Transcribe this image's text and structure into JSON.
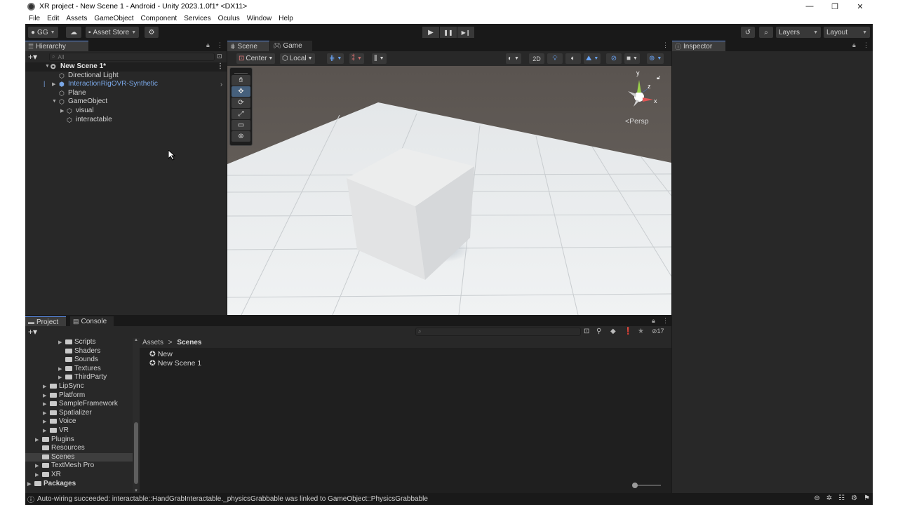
{
  "window": {
    "title": "XR project - New Scene 1 - Android - Unity 2023.1.0f1* <DX11>",
    "controls": [
      "—",
      "❐",
      "✕"
    ]
  },
  "menu": [
    "File",
    "Edit",
    "Assets",
    "GameObject",
    "Component",
    "Services",
    "Oculus",
    "Window",
    "Help"
  ],
  "toolbar": {
    "account": "GG",
    "asset_store": "Asset Store",
    "play": "▶",
    "pause": "❚❚",
    "step": "▶❙",
    "layers": "Layers",
    "layout": "Layout"
  },
  "hierarchy": {
    "tab": "Hierarchy",
    "search_placeholder": "All",
    "scene": "New Scene 1*",
    "items": [
      {
        "label": "Directional Light"
      },
      {
        "label": "InteractionRigOVR-Synthetic"
      },
      {
        "label": "Plane"
      },
      {
        "label": "GameObject"
      },
      {
        "label": "visual"
      },
      {
        "label": "interactable"
      }
    ]
  },
  "scene": {
    "tabs": [
      "Scene",
      "Game"
    ],
    "pivot": "Center",
    "space": "Local",
    "mode_2d": "2D",
    "projection": "Persp",
    "gizmo_axes": [
      "y",
      "x",
      "z"
    ]
  },
  "inspector": {
    "tab": "Inspector"
  },
  "project": {
    "tabs": [
      "Project",
      "Console"
    ],
    "hidden_count": "17",
    "tree": [
      {
        "label": "Scripts"
      },
      {
        "label": "Shaders"
      },
      {
        "label": "Sounds"
      },
      {
        "label": "Textures"
      },
      {
        "label": "ThirdParty"
      },
      {
        "label": "LipSync"
      },
      {
        "label": "Platform"
      },
      {
        "label": "SampleFramework"
      },
      {
        "label": "Spatializer"
      },
      {
        "label": "Voice"
      },
      {
        "label": "VR"
      },
      {
        "label": "Plugins"
      },
      {
        "label": "Resources"
      },
      {
        "label": "Scenes"
      },
      {
        "label": "TextMesh Pro"
      },
      {
        "label": "XR"
      },
      {
        "label": "Packages"
      }
    ],
    "breadcrumb": {
      "root": "Assets",
      "sep": ">",
      "current": "Scenes"
    },
    "assets": [
      "New",
      "New Scene 1"
    ]
  },
  "status": {
    "message": "Auto-wiring succeeded: interactable::HandGrabInteractable._physicsGrabbable was linked to GameObject::PhysicsGrabbable"
  },
  "colors": {
    "accent": "#5a8ae0",
    "prefab_text": "#7aa7e6",
    "panel": "#282828",
    "background": "#191919"
  }
}
